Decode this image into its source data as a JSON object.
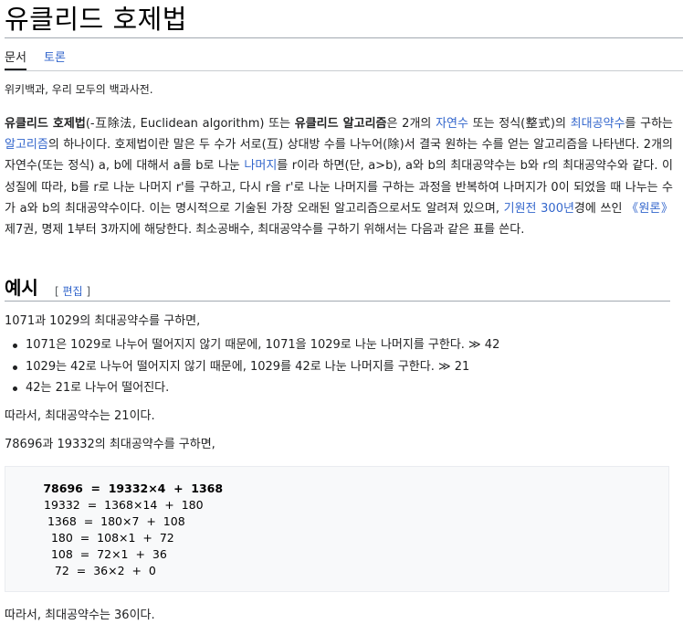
{
  "page": {
    "title": "유클리드 호제법",
    "tabs": [
      {
        "label": "문서",
        "active": true
      },
      {
        "label": "토론",
        "active": false
      }
    ],
    "tagline": "위키백과, 우리 모두의 백과사전."
  },
  "intro": {
    "seg01": "유클리드 호제법",
    "seg02": "(-互除法, Euclidean algorithm) 또는 ",
    "seg03": "유클리드 알고리즘",
    "seg04": "은 2개의 ",
    "seg05": "자연수",
    "seg06": " 또는 정식(整式)의 ",
    "seg07": "최대공약수",
    "seg08": "를 구하는 ",
    "seg09": "알고리즘",
    "seg10": "의 하나이다. 호제법이란 말은 두 수가 서로(互) 상대방 수를 나누어(除)서 결국 원하는 수를 얻는 알고리즘을 나타낸다. 2개의 자연수(또는 정식) a, b에 대해서 a를 b로 나눈 ",
    "seg11": "나머지",
    "seg12": "를 r이라 하면(단, a>b), a와 b의 최대공약수는 b와 r의 최대공약수와 같다. 이 성질에 따라, b를 r로 나눈 나머지 r'를 구하고, 다시 r을 r'로 나눈 나머지를 구하는 과정을 반복하여 나머지가 0이 되었을 때 나누는 수가 a와 b의 최대공약수이다. 이는 명시적으로 기술된 가장 오래된 알고리즘으로서도 알려져 있으며, ",
    "seg13": "기원전 300년",
    "seg14": "경에 쓰인 ",
    "seg15": "《원론》",
    "seg16": " 제7권, 명제 1부터 3까지에 해당한다. 최소공배수, 최대공약수를 구하기 위해서는 다음과 같은 표를 쓴다."
  },
  "section": {
    "heading": "예시",
    "edit_open": "[ ",
    "edit_label": "편집",
    "edit_close": " ]"
  },
  "example1": {
    "intro": "1071과 1029의 최대공약수를 구하면,",
    "bullets": [
      "1071은 1029로 나누어 떨어지지 않기 때문에, 1071을 1029로 나눈 나머지를 구한다. ≫ 42",
      "1029는 42로 나누어 떨어지지 않기 때문에, 1029를 42로 나눈 나머지를 구한다. ≫ 21",
      "42는 21로 나누어 떨어진다."
    ],
    "conclusion": "따라서, 최대공약수는 21이다."
  },
  "example2": {
    "intro": "78696과 19332의 최대공약수를 구하면,",
    "calc": [
      " 78696  =  19332×4  +  1368",
      "19332  =  1368×14  +  180",
      " 1368  =  180×7  +  108",
      "  180  =  108×1  +  72",
      "  108  =  72×1  +  36",
      "   72  =  36×2  +  0"
    ],
    "conclusion": "따라서, 최대공약수는 36이다."
  }
}
